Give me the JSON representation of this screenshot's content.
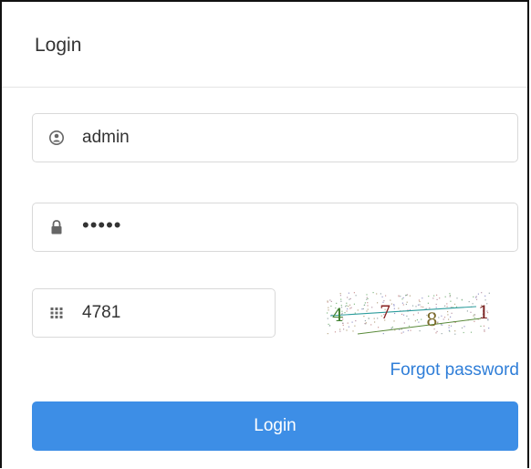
{
  "login_panel": {
    "title": "Login"
  },
  "username": {
    "value": "admin",
    "icon": "user-icon"
  },
  "password": {
    "masked_value": "•••••",
    "icon": "lock-icon"
  },
  "captcha": {
    "value": "4781",
    "icon": "keypad-icon",
    "image_text": "4781"
  },
  "forgot_password": {
    "label": "Forgot password"
  },
  "login_button": {
    "label": "Login",
    "color": "#3d8ee6"
  },
  "colors": {
    "link": "#2f7ed8",
    "border": "#d9d9d9",
    "text": "#333333"
  }
}
